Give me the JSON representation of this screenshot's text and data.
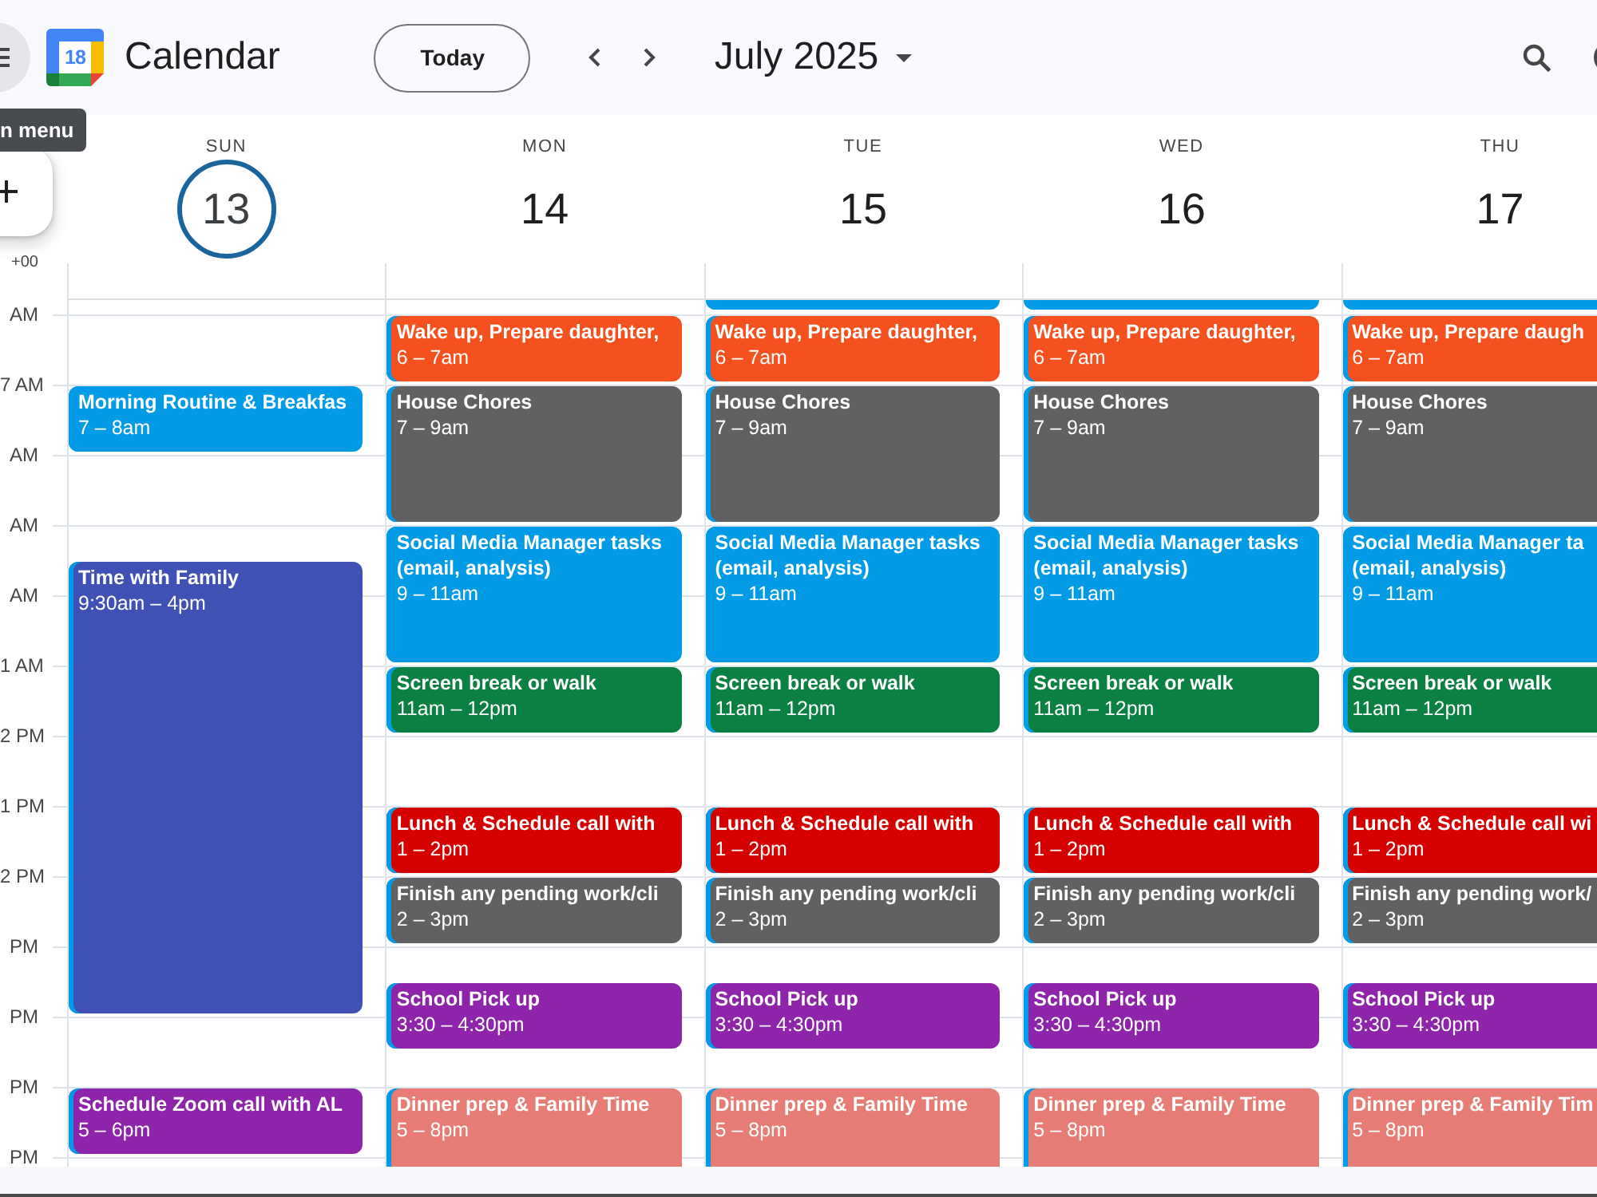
{
  "top_bar": {
    "menu_tooltip": "n menu",
    "logo_date": "18",
    "app_name": "Calendar",
    "today_button": "Today",
    "period": "July 2025"
  },
  "time_zone": "+00",
  "hours": [
    "AM",
    "7 AM",
    "AM",
    "AM",
    "AM",
    "1 AM",
    "2 PM",
    "1 PM",
    "2 PM",
    "PM",
    "PM",
    "PM",
    "PM"
  ],
  "days": [
    {
      "weekday": "SUN",
      "date": "13",
      "selected": true,
      "events": [
        {
          "kind": "timed",
          "title": "Morning Routine & Breakfas",
          "time": "7 – 8am",
          "color": "#039be5"
        },
        {
          "kind": "timed",
          "title": "Time with Family",
          "time": "9:30am – 4pm",
          "color": "#3f51b5"
        },
        {
          "kind": "timed",
          "title": "Schedule Zoom call with AL",
          "time": "5 – 6pm",
          "color": "#8e24aa"
        }
      ]
    },
    {
      "weekday": "MON",
      "date": "14",
      "selected": false,
      "events": [
        {
          "kind": "timed",
          "title": "Wake up, Prepare daughter,",
          "time": "6 – 7am",
          "color": "#f4511e"
        },
        {
          "kind": "timed",
          "title": "House Chores",
          "time": "7 – 9am",
          "color": "#616161"
        },
        {
          "kind": "timed",
          "title": "Social Media Manager tasks (email, analysis)",
          "time": "9 – 11am",
          "color": "#039be5"
        },
        {
          "kind": "timed",
          "title": "Screen break or walk",
          "time": "11am – 12pm",
          "color": "#0b8043"
        },
        {
          "kind": "timed",
          "title": "Lunch & Schedule call with",
          "time": "1 – 2pm",
          "color": "#d50000"
        },
        {
          "kind": "timed",
          "title": "Finish any pending work/cli",
          "time": "2 – 3pm",
          "color": "#616161"
        },
        {
          "kind": "timed",
          "title": "School Pick up",
          "time": "3:30 – 4:30pm",
          "color": "#8e24aa"
        },
        {
          "kind": "timed",
          "title": "Dinner prep & Family Time",
          "time": "5 – 8pm",
          "color": "#e67c73"
        }
      ]
    },
    {
      "weekday": "TUE",
      "date": "15",
      "selected": false,
      "events": [
        {
          "kind": "continued",
          "color": "#039be5"
        },
        {
          "kind": "timed",
          "title": "Wake up, Prepare daughter,",
          "time": "6 – 7am",
          "color": "#f4511e"
        },
        {
          "kind": "timed",
          "title": "House Chores",
          "time": "7 – 9am",
          "color": "#616161"
        },
        {
          "kind": "timed",
          "title": "Social Media Manager tasks (email, analysis)",
          "time": "9 – 11am",
          "color": "#039be5"
        },
        {
          "kind": "timed",
          "title": "Screen break or walk",
          "time": "11am – 12pm",
          "color": "#0b8043"
        },
        {
          "kind": "timed",
          "title": "Lunch & Schedule call with",
          "time": "1 – 2pm",
          "color": "#d50000"
        },
        {
          "kind": "timed",
          "title": "Finish any pending work/cli",
          "time": "2 – 3pm",
          "color": "#616161"
        },
        {
          "kind": "timed",
          "title": "School Pick up",
          "time": "3:30 – 4:30pm",
          "color": "#8e24aa"
        },
        {
          "kind": "timed",
          "title": "Dinner prep & Family Time",
          "time": "5 – 8pm",
          "color": "#e67c73"
        }
      ]
    },
    {
      "weekday": "WED",
      "date": "16",
      "selected": false,
      "events": [
        {
          "kind": "continued",
          "color": "#039be5"
        },
        {
          "kind": "timed",
          "title": "Wake up, Prepare daughter,",
          "time": "6 – 7am",
          "color": "#f4511e"
        },
        {
          "kind": "timed",
          "title": "House Chores",
          "time": "7 – 9am",
          "color": "#616161"
        },
        {
          "kind": "timed",
          "title": "Social Media Manager tasks (email, analysis)",
          "time": "9 – 11am",
          "color": "#039be5"
        },
        {
          "kind": "timed",
          "title": "Screen break or walk",
          "time": "11am – 12pm",
          "color": "#0b8043"
        },
        {
          "kind": "timed",
          "title": "Lunch & Schedule call with",
          "time": "1 – 2pm",
          "color": "#d50000"
        },
        {
          "kind": "timed",
          "title": "Finish any pending work/cli",
          "time": "2 – 3pm",
          "color": "#616161"
        },
        {
          "kind": "timed",
          "title": "School Pick up",
          "time": "3:30 – 4:30pm",
          "color": "#8e24aa"
        },
        {
          "kind": "timed",
          "title": "Dinner prep & Family Time",
          "time": "5 – 8pm",
          "color": "#e67c73"
        }
      ]
    },
    {
      "weekday": "THU",
      "date": "17",
      "selected": false,
      "events": [
        {
          "kind": "continued",
          "color": "#039be5"
        },
        {
          "kind": "timed",
          "title": "Wake up, Prepare daugh",
          "time": "6 – 7am",
          "color": "#f4511e"
        },
        {
          "kind": "timed",
          "title": "House Chores",
          "time": "7 – 9am",
          "color": "#616161"
        },
        {
          "kind": "timed",
          "title": "Social Media Manager ta (email, analysis)",
          "time": "9 – 11am",
          "color": "#039be5"
        },
        {
          "kind": "timed",
          "title": "Screen break or walk",
          "time": "11am – 12pm",
          "color": "#0b8043"
        },
        {
          "kind": "timed",
          "title": "Lunch & Schedule call wi",
          "time": "1 – 2pm",
          "color": "#d50000"
        },
        {
          "kind": "timed",
          "title": "Finish any pending work/",
          "time": "2 – 3pm",
          "color": "#616161"
        },
        {
          "kind": "timed",
          "title": "School Pick up",
          "time": "3:30 – 4:30pm",
          "color": "#8e24aa"
        },
        {
          "kind": "timed",
          "title": "Dinner prep & Family Tim",
          "time": "5 – 8pm",
          "color": "#e67c73"
        }
      ]
    }
  ]
}
